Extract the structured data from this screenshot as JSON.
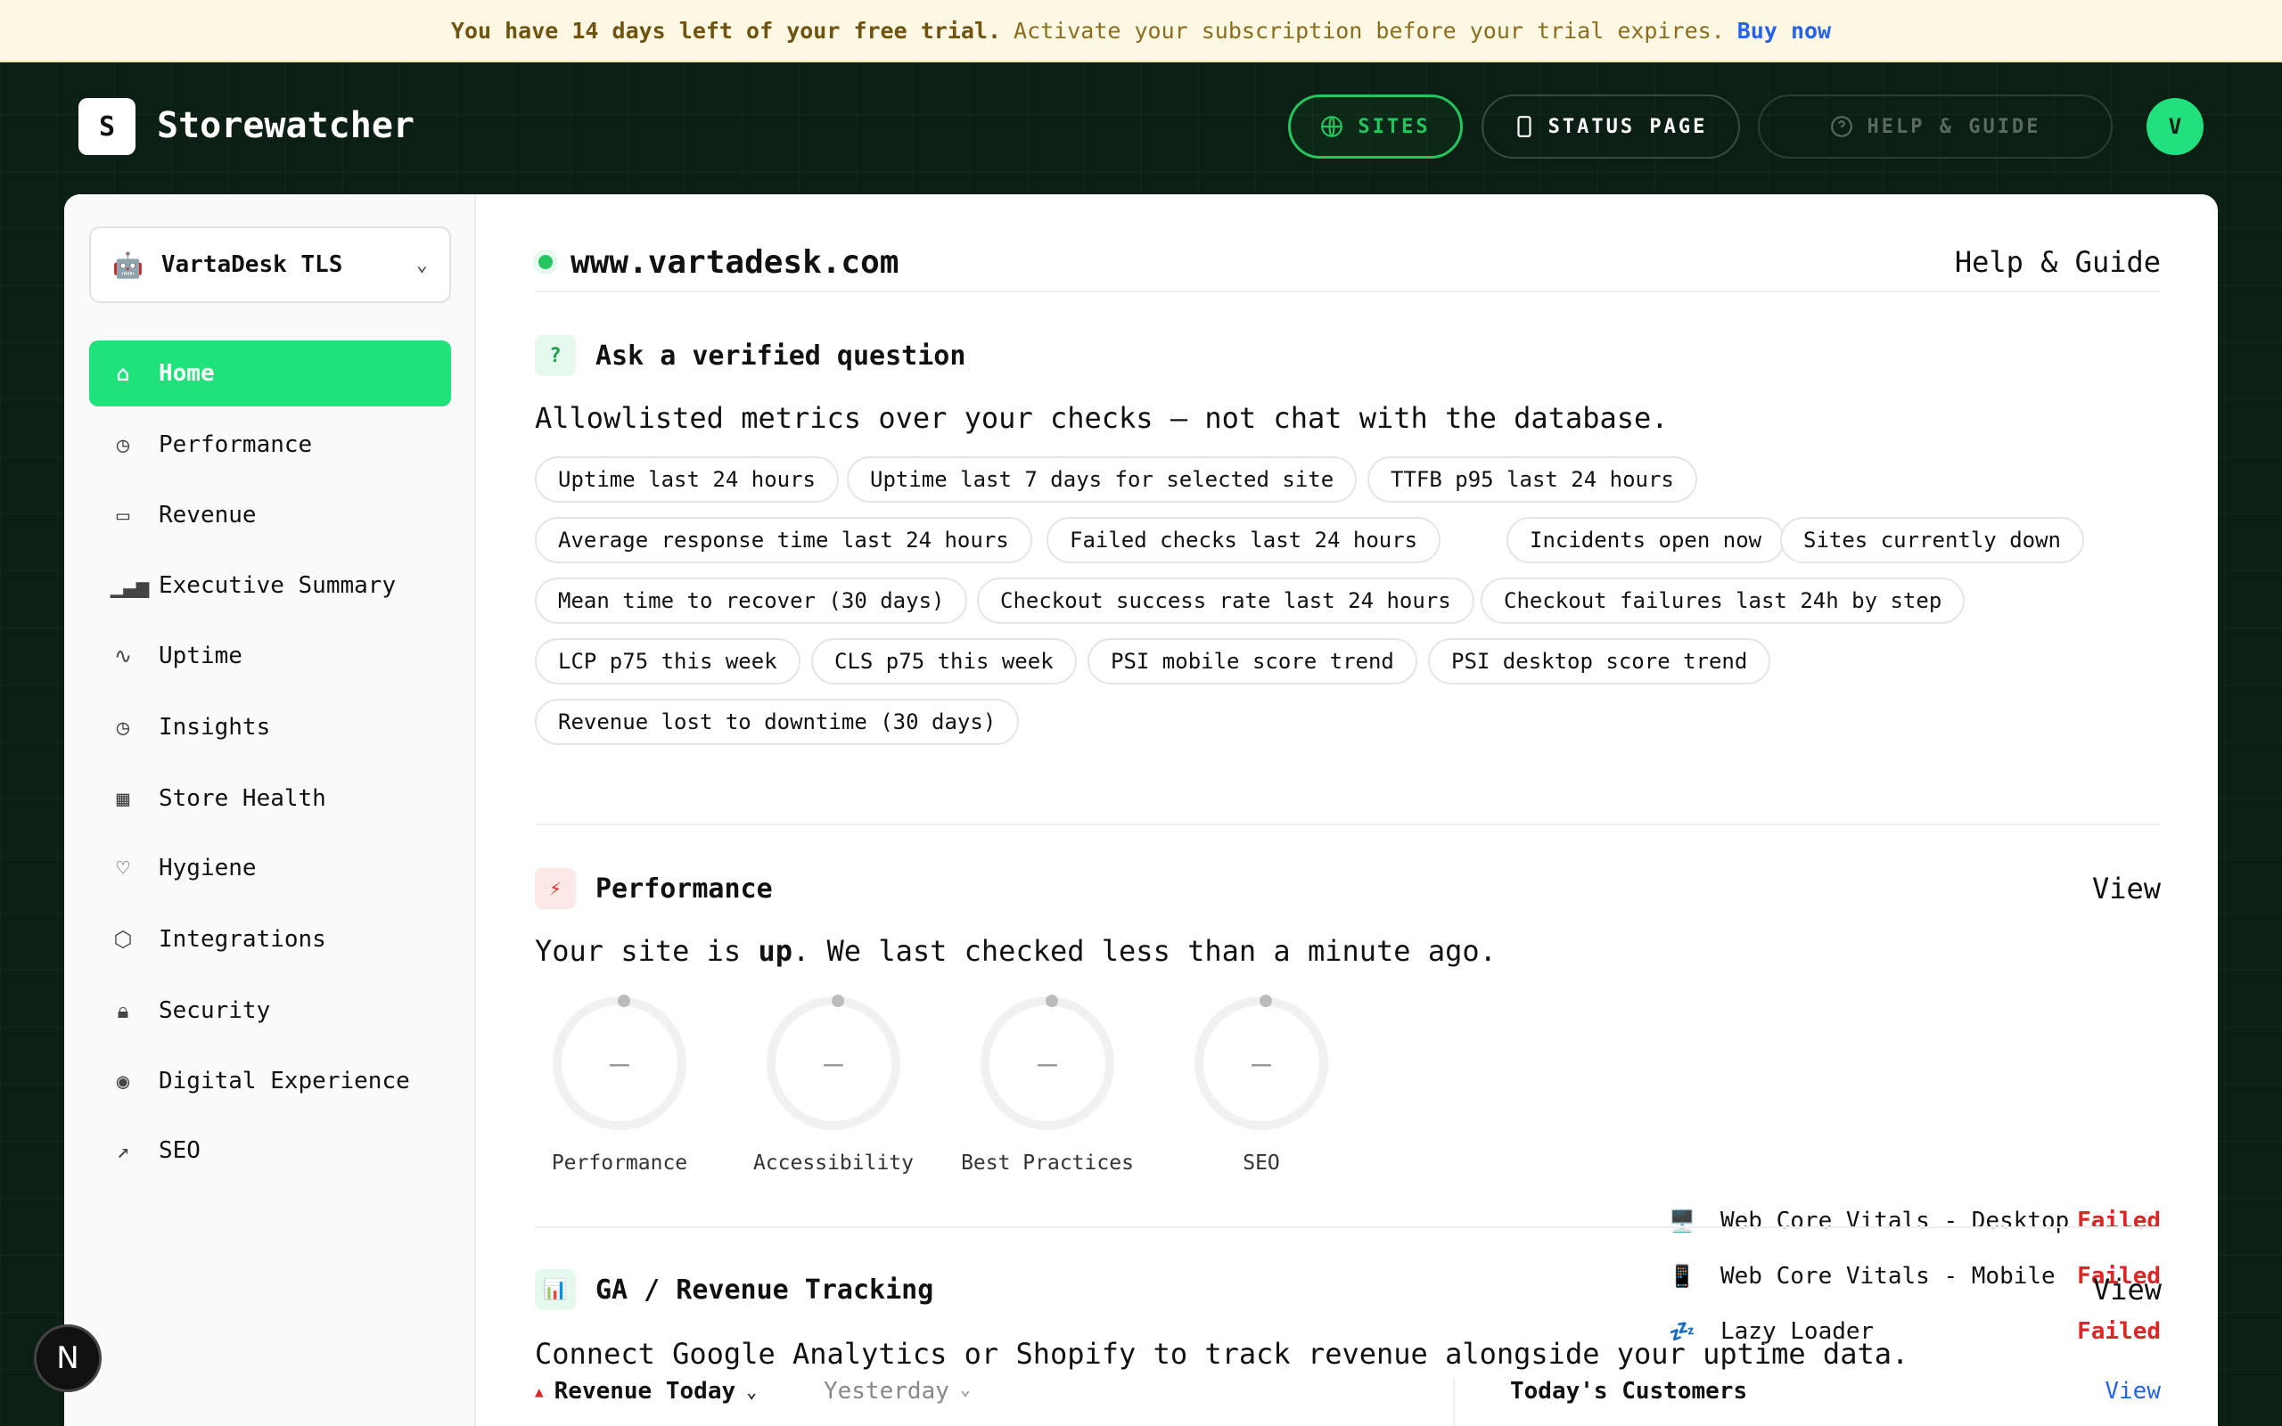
{
  "trial": {
    "strong": "You have 14 days left of your free trial.",
    "message": "Activate your subscription before your trial expires.",
    "buy": "Buy now"
  },
  "brand": {
    "logo_letter": "S",
    "name": "Storewatcher"
  },
  "topnav": {
    "sites": "SITES",
    "status_page": "STATUS PAGE",
    "help": "HELP & GUIDE",
    "avatar": "V"
  },
  "sidebar": {
    "site_name": "VartaDesk TLS",
    "items": [
      {
        "label": "Home",
        "icon": "home-icon"
      },
      {
        "label": "Performance",
        "icon": "clock-icon"
      },
      {
        "label": "Revenue",
        "icon": "card-icon"
      },
      {
        "label": "Executive Summary",
        "icon": "bar-chart-icon"
      },
      {
        "label": "Uptime",
        "icon": "pulse-icon"
      },
      {
        "label": "Insights",
        "icon": "clock-icon"
      },
      {
        "label": "Store Health",
        "icon": "grid-icon"
      },
      {
        "label": "Hygiene",
        "icon": "heart-icon"
      },
      {
        "label": "Integrations",
        "icon": "box-icon"
      },
      {
        "label": "Security",
        "icon": "lock-icon"
      },
      {
        "label": "Digital Experience",
        "icon": "eye-icon"
      },
      {
        "label": "SEO",
        "icon": "trend-icon"
      }
    ]
  },
  "main": {
    "site_url": "www.vartadesk.com",
    "help_link": "Help & Guide",
    "ask": {
      "icon": "?",
      "title": "Ask a verified question",
      "description": "Allowlisted metrics over your checks — not chat with the database.",
      "chips": [
        "Uptime last 24 hours",
        "Uptime last 7 days for selected site",
        "TTFB p95 last 24 hours",
        "Average response time last 24 hours",
        "Failed checks last 24 hours",
        "Incidents open now",
        "Sites currently down",
        "Mean time to recover (30 days)",
        "Checkout success rate last 24 hours",
        "Checkout failures last 24h by step",
        "LCP p75 this week",
        "CLS p75 this week",
        "PSI mobile score trend",
        "PSI desktop score trend",
        "Revenue lost to downtime (30 days)"
      ]
    },
    "performance": {
      "icon": "⚡",
      "title": "Performance",
      "view": "View",
      "status_pre": "Your site is ",
      "status_word": "up",
      "status_post": ". We last checked less than a minute ago.",
      "gauges": [
        {
          "label": "Performance",
          "value": "–"
        },
        {
          "label": "Accessibility",
          "value": "–"
        },
        {
          "label": "Best Practices",
          "value": "–"
        },
        {
          "label": "SEO",
          "value": "–"
        }
      ],
      "checks": [
        {
          "icon": "🖥️",
          "label": "Web Core Vitals - Desktop",
          "status": "Failed"
        },
        {
          "icon": "📱",
          "label": "Web Core Vitals - Mobile",
          "status": "Failed"
        },
        {
          "icon": "💤",
          "label": "Lazy Loader",
          "status": "Failed"
        }
      ]
    },
    "ga": {
      "icon": "📊",
      "title": "GA / Revenue Tracking",
      "view": "View",
      "description": "Connect Google Analytics or Shopify to track revenue alongside your uptime data.",
      "revenue_today": "Revenue Today",
      "yesterday": "Yesterday",
      "customers": "Today's Customers",
      "customers_view": "View"
    }
  },
  "badge": "N"
}
